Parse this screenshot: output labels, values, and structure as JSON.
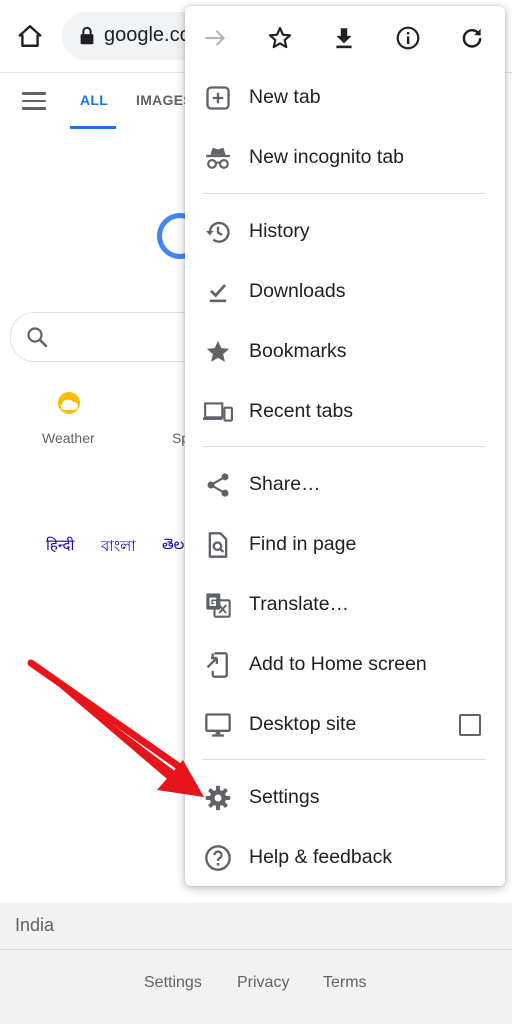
{
  "browser": {
    "url": "google.co",
    "home_icon": "home-icon",
    "lock_icon": "lock-icon"
  },
  "google_page": {
    "tabs": [
      {
        "label": "ALL",
        "active": true
      },
      {
        "label": "IMAGES",
        "active": false
      }
    ],
    "menu_icon": "hamburger-icon",
    "shortcuts": [
      {
        "label": "Weather",
        "icon": "weather-icon"
      },
      {
        "label": "Sp",
        "icon": "sports-icon"
      }
    ],
    "languages": [
      "हिन्दी",
      "বাংলা",
      "తెల"
    ],
    "footer": {
      "country": "India",
      "links": [
        "Settings",
        "Privacy",
        "Terms"
      ]
    }
  },
  "menu": {
    "toolbar": [
      {
        "icon": "forward-arrow-icon",
        "enabled": false
      },
      {
        "icon": "star-icon",
        "enabled": true
      },
      {
        "icon": "download-icon",
        "enabled": true
      },
      {
        "icon": "info-icon",
        "enabled": true
      },
      {
        "icon": "reload-icon",
        "enabled": true
      }
    ],
    "items": [
      {
        "label": "New tab",
        "icon": "plus-box-icon"
      },
      {
        "label": "New incognito tab",
        "icon": "incognito-icon"
      },
      {
        "label": "History",
        "icon": "history-icon"
      },
      {
        "label": "Downloads",
        "icon": "download-check-icon"
      },
      {
        "label": "Bookmarks",
        "icon": "star-filled-icon"
      },
      {
        "label": "Recent tabs",
        "icon": "devices-icon"
      },
      {
        "label": "Share…",
        "icon": "share-icon"
      },
      {
        "label": "Find in page",
        "icon": "find-in-page-icon"
      },
      {
        "label": "Translate…",
        "icon": "translate-icon"
      },
      {
        "label": "Add to Home screen",
        "icon": "add-to-home-icon"
      },
      {
        "label": "Desktop site",
        "icon": "desktop-icon",
        "checked": false
      },
      {
        "label": "Settings",
        "icon": "gear-icon"
      },
      {
        "label": "Help & feedback",
        "icon": "help-icon"
      }
    ]
  },
  "colors": {
    "accent": "#1a73e8",
    "icon_gray": "#5f6368",
    "annotation_arrow": "#e8141b"
  }
}
